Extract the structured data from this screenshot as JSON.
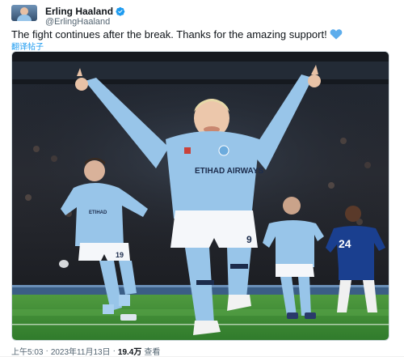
{
  "user": {
    "display_name": "Erling Haaland",
    "handle": "@ErlingHaaland",
    "verified": true,
    "avatar_icon": "avatar-photo"
  },
  "tweet": {
    "text": "The fight continues after the break. Thanks for the amazing support!",
    "emoji_icon": "blue-heart-icon",
    "translate_label": "翻译帖子"
  },
  "media": {
    "description_icon": "photo",
    "kit_text": "ETIHAD AIRWAYS",
    "shirt_number_main": "9",
    "shirt_number_left": "19",
    "opponent_number": "24"
  },
  "footer": {
    "time": "上午5:03",
    "separator": "·",
    "date": "2023年11月13日",
    "views_count": "19.4万",
    "views_label": "查看"
  },
  "colors": {
    "city_blue": "#98c5e9",
    "chelsea_blue": "#1a3f8f",
    "link_blue": "#1d9bf0",
    "pitch_green": "#3f8a35"
  }
}
